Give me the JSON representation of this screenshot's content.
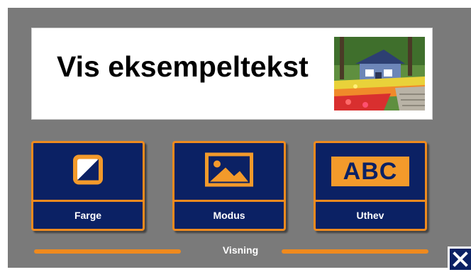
{
  "preview": {
    "sample_text": "Vis eksempeltekst",
    "image": "garden-house-tulips-photo"
  },
  "tiles": [
    {
      "label": "Farge",
      "icon": "color-contrast-icon"
    },
    {
      "label": "Modus",
      "icon": "image-mode-icon"
    },
    {
      "label": "Uthev",
      "icon": "abc-highlight-icon",
      "icon_text": "ABC"
    }
  ],
  "slider": {
    "label": "Visning"
  },
  "close": {
    "icon": "close-icon"
  },
  "colors": {
    "background": "#7a7a7a",
    "tile": "#0b2164",
    "accent": "#ef8a1e",
    "text": "#ffffff"
  }
}
